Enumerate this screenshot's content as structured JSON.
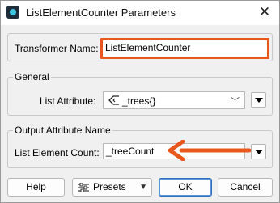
{
  "window": {
    "title": "ListElementCounter Parameters",
    "close_glyph": "✕"
  },
  "transformer": {
    "label": "Transformer Name:",
    "value": "ListElementCounter"
  },
  "general": {
    "title": "General",
    "list_attribute_label": "List Attribute:",
    "list_attribute_value": "_trees{}",
    "list_attribute_icon": "list-attribute-icon"
  },
  "output": {
    "title": "Output Attribute Name",
    "list_element_count_label": "List Element Count:",
    "list_element_count_value": "_treeCount"
  },
  "buttons": {
    "help": "Help",
    "presets": "Presets",
    "ok": "OK",
    "cancel": "Cancel"
  },
  "annotation": {
    "highlight_color": "#e8581c",
    "arrow_color": "#e8581c"
  }
}
